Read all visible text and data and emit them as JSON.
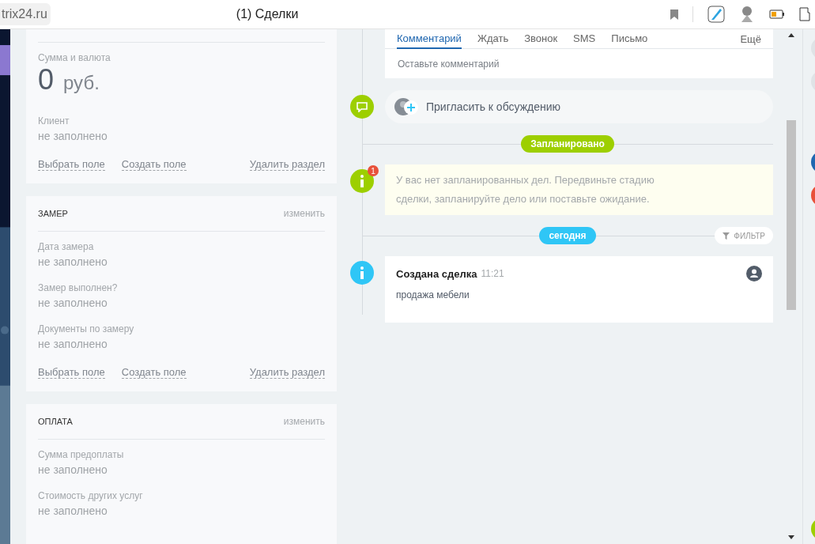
{
  "browser": {
    "url": "trix24.ru",
    "title": "(1) Сделки"
  },
  "sections": [
    {
      "fields": [
        {
          "kind": "money",
          "label": "Сумма и валюта",
          "value": "0",
          "unit": "руб."
        },
        {
          "kind": "text",
          "label": "Клиент",
          "value": "не заполнено"
        }
      ],
      "actions": [
        "Выбрать поле",
        "Создать поле",
        "Удалить раздел"
      ]
    },
    {
      "title": "ЗАМЕР",
      "edit": "изменить",
      "fields": [
        {
          "kind": "text",
          "label": "Дата замера",
          "value": "не заполнено"
        },
        {
          "kind": "text",
          "label": "Замер выполнен?",
          "value": "не заполнено"
        },
        {
          "kind": "text",
          "label": "Документы по замеру",
          "value": "не заполнено"
        }
      ],
      "actions": [
        "Выбрать поле",
        "Создать поле",
        "Удалить раздел"
      ]
    },
    {
      "title": "ОПЛАТА",
      "edit": "изменить",
      "fields": [
        {
          "kind": "text",
          "label": "Сумма предоплаты",
          "value": "не заполнено"
        },
        {
          "kind": "text",
          "label": "Стоимость других услуг",
          "value": "не заполнено"
        }
      ]
    }
  ],
  "timeline": {
    "tabs": [
      {
        "label": "Комментарий",
        "selected": true
      },
      {
        "label": "Ждать",
        "selected": false
      },
      {
        "label": "Звонок",
        "selected": false
      },
      {
        "label": "SMS",
        "selected": false
      },
      {
        "label": "Письмо",
        "selected": false
      }
    ],
    "more": "Ещё",
    "comment_placeholder": "Оставьте комментарий",
    "invite": "Пригласить к обсуждению",
    "planned_badge": "Запланировано",
    "notice": {
      "counter": "1",
      "text": "У вас нет запланированных дел. Передвиньте стадию сделки, запланируйте дело или поставьте ожидание."
    },
    "today_badge": "сегодня",
    "filter": "ФИЛЬТР",
    "events": [
      {
        "title": "Создана сделка",
        "time": "11:21",
        "text": "продажа мебели"
      }
    ]
  }
}
